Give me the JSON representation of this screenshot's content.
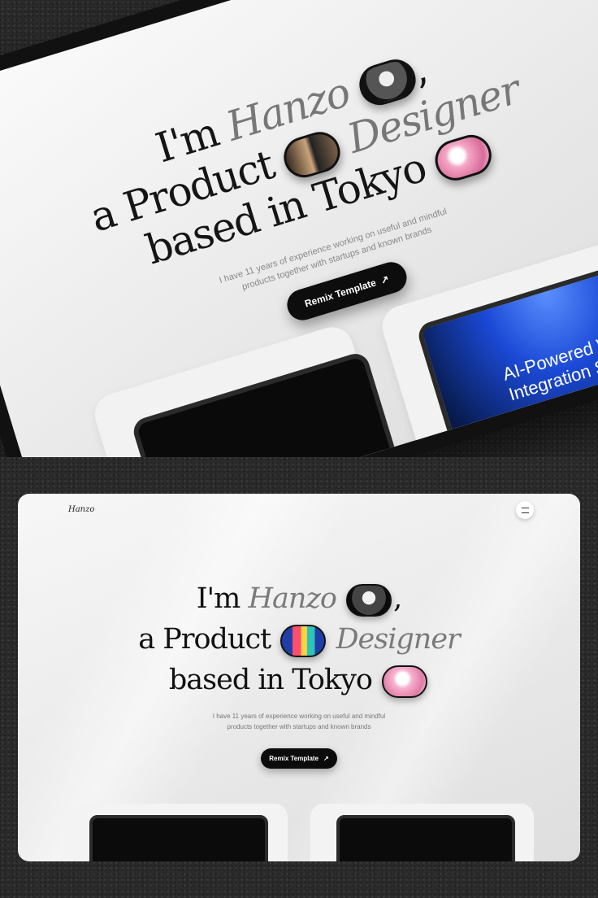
{
  "brand": {
    "logo_text": "Hanzo"
  },
  "hero": {
    "line1_prefix": "I'm",
    "name": "Hanzo",
    "line1_suffix": ",",
    "line2_prefix": "a Product",
    "line2_italic": "Designer",
    "line3": "based in Tokyo",
    "subtitle_line1": "I have 11 years of experience working on useful and mindful",
    "subtitle_line2": "products together with startups and known brands",
    "cta_label": "Remix Template",
    "cta_icon": "arrow-up-right-icon"
  },
  "preview_tablet": {
    "headline_line1": "AI-Powered W",
    "headline_line2": "Integration S"
  },
  "colors": {
    "page_background": "#2b2b2b",
    "frame_background": "#efefef",
    "text_primary": "#111111",
    "text_italic": "#7a7a7a",
    "cta_background": "#0b0b0b",
    "accent_blue": "#1b49d6"
  }
}
